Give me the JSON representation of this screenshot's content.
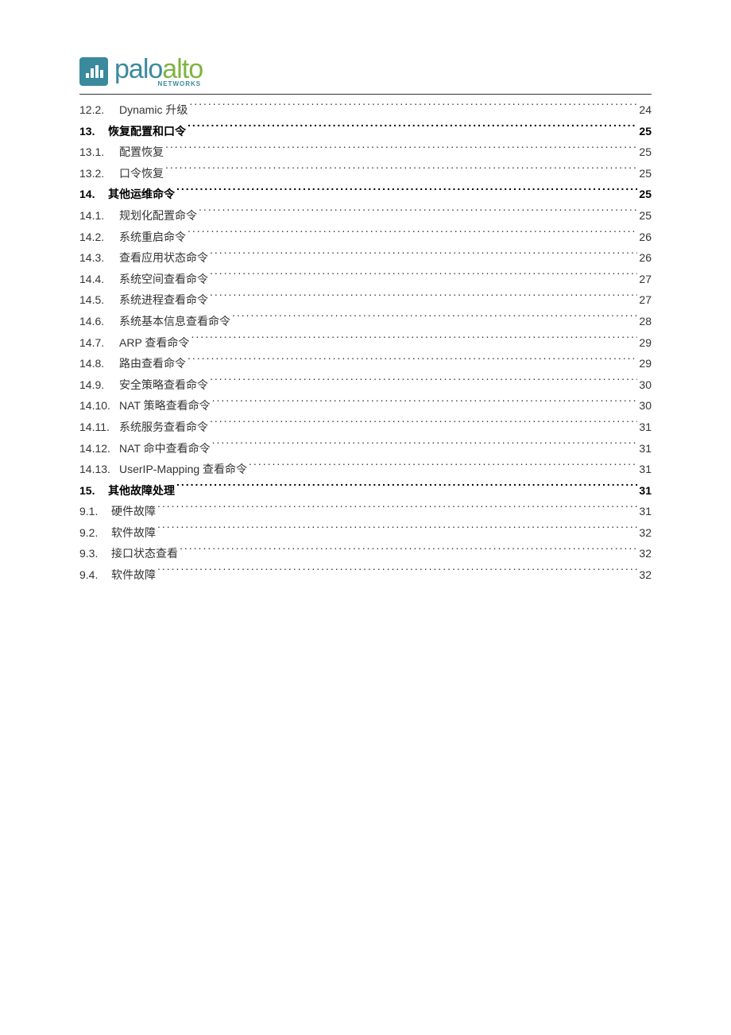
{
  "logo": {
    "palo": "palo",
    "alto": "alto",
    "sub": "NETWORKS"
  },
  "toc": [
    {
      "num": "12.2.",
      "title": "Dynamic 升级",
      "page": "24",
      "level": "sub",
      "bold": false
    },
    {
      "num": "13.",
      "title": "恢复配置和口令",
      "page": "25",
      "level": "top",
      "bold": true
    },
    {
      "num": "13.1.",
      "title": "配置恢复",
      "page": "25",
      "level": "sub",
      "bold": false
    },
    {
      "num": "13.2.",
      "title": "口令恢复",
      "page": "25",
      "level": "sub",
      "bold": false
    },
    {
      "num": "14.",
      "title": "其他运维命令",
      "page": "25",
      "level": "top",
      "bold": true
    },
    {
      "num": "14.1.",
      "title": "规划化配置命令",
      "page": "25",
      "level": "sub",
      "bold": false
    },
    {
      "num": "14.2.",
      "title": "系统重启命令",
      "page": "26",
      "level": "sub",
      "bold": false
    },
    {
      "num": "14.3.",
      "title": "查看应用状态命令",
      "page": "26",
      "level": "sub",
      "bold": false
    },
    {
      "num": "14.4.",
      "title": "系统空间查看命令",
      "page": "27",
      "level": "sub",
      "bold": false
    },
    {
      "num": "14.5.",
      "title": "系统进程查看命令",
      "page": "27",
      "level": "sub",
      "bold": false
    },
    {
      "num": "14.6.",
      "title": "系统基本信息查看命令",
      "page": "28",
      "level": "sub",
      "bold": false
    },
    {
      "num": "14.7.",
      "title": "ARP 查看命令",
      "page": "29",
      "level": "sub",
      "bold": false
    },
    {
      "num": "14.8.",
      "title": "路由查看命令",
      "page": "29",
      "level": "sub",
      "bold": false
    },
    {
      "num": "14.9.",
      "title": "安全策略查看命令",
      "page": "30",
      "level": "sub",
      "bold": false
    },
    {
      "num": "14.10.",
      "title": "NAT 策略查看命令",
      "page": "30",
      "level": "sub",
      "bold": false
    },
    {
      "num": "14.11.",
      "title": "系统服务查看命令",
      "page": "31",
      "level": "sub",
      "bold": false
    },
    {
      "num": "14.12.",
      "title": "NAT 命中查看命令",
      "page": "31",
      "level": "sub",
      "bold": false
    },
    {
      "num": "14.13.",
      "title": "UserIP-Mapping 查看命令",
      "page": "31",
      "level": "sub",
      "bold": false
    },
    {
      "num": "15.",
      "title": "其他故障处理",
      "page": "31",
      "level": "top",
      "bold": true
    },
    {
      "num": "9.1.",
      "title": "硬件故障",
      "page": "31",
      "level": "sub2",
      "bold": false
    },
    {
      "num": "9.2.",
      "title": "软件故障",
      "page": "32",
      "level": "sub2",
      "bold": false
    },
    {
      "num": "9.3.",
      "title": "接口状态查看",
      "page": "32",
      "level": "sub2",
      "bold": false
    },
    {
      "num": "9.4.",
      "title": "软件故障",
      "page": "32",
      "level": "sub2",
      "bold": false
    }
  ]
}
